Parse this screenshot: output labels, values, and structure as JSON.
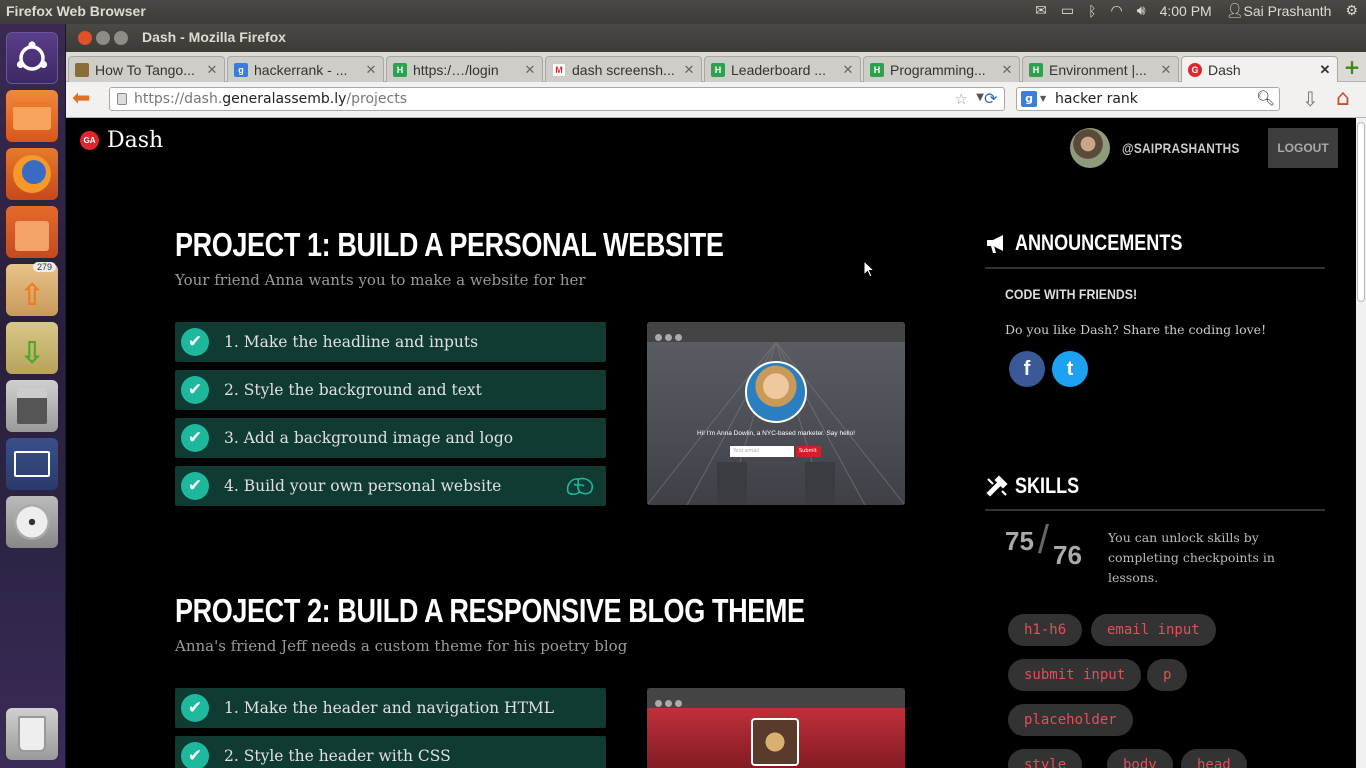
{
  "top_panel": {
    "app_title": "Firefox Web Browser",
    "clock": "4:00 PM",
    "user": "Sai Prashanth"
  },
  "launcher": {
    "updates_badge": "279",
    "items": [
      "ubuntu-dash",
      "files",
      "firefox",
      "software-center",
      "update-manager",
      "downloads",
      "calculator",
      "workspaces",
      "dvd-burner",
      "trash"
    ]
  },
  "window": {
    "title": "Dash - Mozilla Firefox"
  },
  "tabs": [
    {
      "label": "How To Tango...",
      "favicon_color": "#8a6d3b"
    },
    {
      "label": "hackerrank - ...",
      "favicon_color": "#3b7ddd"
    },
    {
      "label": "https:/…/login",
      "favicon_color": "#2ca24f"
    },
    {
      "label": "dash screensh...",
      "favicon_color": "#d93025"
    },
    {
      "label": "Leaderboard ...",
      "favicon_color": "#2ca24f"
    },
    {
      "label": "Programming...",
      "favicon_color": "#2ca24f"
    },
    {
      "label": "Environment |...",
      "favicon_color": "#2ca24f"
    },
    {
      "label": "Dash",
      "favicon_color": "#e0262d"
    }
  ],
  "urlbar": {
    "prefix": "https://dash.",
    "domain": "generalassemb.ly",
    "path": "/projects"
  },
  "searchbar": {
    "value": "hacker rank"
  },
  "header": {
    "brand": "Dash",
    "brand_badge": "GA",
    "username": "@SAIPRASHANTHS",
    "logout_label": "LOGOUT"
  },
  "projects": [
    {
      "title": "PROJECT 1: BUILD A PERSONAL WEBSITE",
      "subtitle": "Your friend Anna wants you to make a website for her",
      "steps": [
        "1. Make the headline and inputs",
        "2. Style the background and text",
        "3. Add a background image and logo",
        "4. Build your own personal website"
      ],
      "preview": {
        "caption": "Hi! I'm Anna Dowlin, a NYC-based marketer. Say hello!",
        "email_placeholder": "Your email",
        "submit_label": "Submit"
      }
    },
    {
      "title": "PROJECT 2: BUILD A RESPONSIVE BLOG THEME",
      "subtitle": "Anna's friend Jeff needs a custom theme for his poetry blog",
      "steps": [
        "1. Make the header and navigation HTML",
        "2. Style the header with CSS"
      ]
    }
  ],
  "sidebar": {
    "announcements_title": "ANNOUNCEMENTS",
    "code_with_friends_title": "CODE WITH FRIENDS!",
    "code_with_friends_text": "Do you like Dash? Share the coding love!",
    "facebook_glyph": "f",
    "twitter_glyph": "t",
    "skills_title": "SKILLS",
    "skills_unlocked": "75",
    "skills_separator": "/",
    "skills_total": "76",
    "skills_text": "You can unlock skills by completing checkpoints in lessons.",
    "skill_chips": [
      "h1-h6",
      "email input",
      "submit input",
      "p",
      "placeholder",
      "style",
      "body",
      "head"
    ]
  },
  "colors": {
    "step_bg": "#0f3b33",
    "check": "#1eb89c",
    "chip_text": "#e0505a",
    "brand_red": "#e0262d"
  }
}
